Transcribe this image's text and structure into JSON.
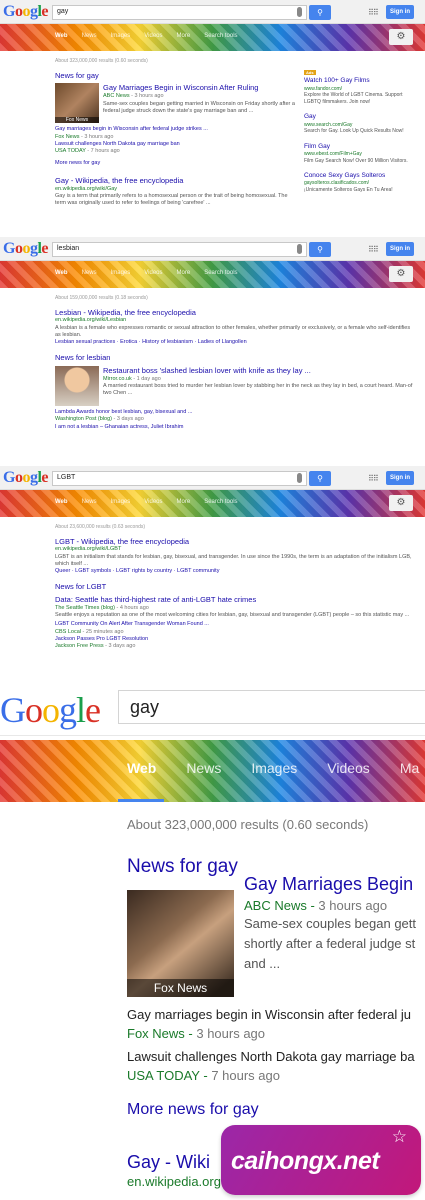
{
  "logo": {
    "g1": "G",
    "o1": "o",
    "o2": "o",
    "g2": "g",
    "l": "l",
    "e": "e"
  },
  "header": {
    "signin": "Sign in"
  },
  "tabs": [
    "Web",
    "News",
    "Images",
    "Videos",
    "More",
    "Search tools"
  ],
  "big_tabs": [
    "Web",
    "News",
    "Images",
    "Videos",
    "Ma"
  ],
  "panel1": {
    "query": "gay",
    "stats": "About 323,000,000 results (0.60 seconds)",
    "news_heading": "News for gay",
    "story": {
      "title": "Gay Marriages Begin in Wisconsin After Ruling",
      "source": "ABC News",
      "time": "3 hours ago",
      "snippet": "Same-sex couples began getting married in Wisconsin on Friday shortly after a federal judge struck down the state's gay marriage ban and ...",
      "thumb_caption": "Fox News"
    },
    "related": [
      {
        "title": "Gay marriages begin in Wisconsin after federal judge strikes ...",
        "source": "Fox News",
        "time": "3 hours ago"
      },
      {
        "title": "Lawsuit challenges North Dakota gay marriage ban",
        "source": "USA TODAY",
        "time": "7 hours ago"
      }
    ],
    "more_news": "More news for gay",
    "result": {
      "title": "Gay - Wikipedia, the free encyclopedia",
      "url": "en.wikipedia.org/wiki/Gay",
      "snippet": "Gay is a term that primarily refers to a homosexual person or the trait of being homosexual. The term was originally used to refer to feelings of being 'carefree' ..."
    },
    "ads": [
      {
        "title": "Watch 100+ Gay Films",
        "url": "www.fandor.com/",
        "desc": "Explore the World of LGBT Cinema. Support LGBTQ filmmakers. Join now!"
      },
      {
        "title": "Gay",
        "url": "www.search.com/Gay",
        "desc": "Search for Gay. Look Up Quick Results Now!"
      },
      {
        "title": "Film Gay",
        "url": "www.ebest.com/Film+Gay",
        "desc": "Film Gay Search Now! Over 90 Million Visitors."
      },
      {
        "title": "Conoce Sexy Gays Solteros",
        "url": "gaysolteros.clasificados.com/",
        "desc": "¡Unicamente Solteros Gays En Tu Area!"
      }
    ],
    "ad_tag": "Ads"
  },
  "panel2": {
    "query": "lesbian",
    "stats": "About 159,000,000 results (0.18 seconds)",
    "result": {
      "title": "Lesbian - Wikipedia, the free encyclopedia",
      "url": "en.wikipedia.org/wiki/Lesbian",
      "snippet": "A lesbian is a female who expresses romantic or sexual attraction to other females, whether primarily or exclusively, or a female who self-identifies as lesbian.",
      "sitelinks": "Lesbian sexual practices · Erotica · History of lesbianism · Ladies of Llangollen"
    },
    "news_heading": "News for lesbian",
    "story": {
      "title": "Restaurant boss 'slashed lesbian lover with knife as they lay ...",
      "source": "Mirror.co.uk",
      "time": "1 day ago",
      "snippet": "A married restaurant boss tried to murder her lesbian lover by stabbing her in the neck as they lay in bed, a court heard. Man-of two Chen ..."
    },
    "related": [
      {
        "title": "Lambda Awards honor best lesbian, gay, bisexual and ...",
        "source": "Washington Post (blog)",
        "time": "3 days ago"
      },
      {
        "title": "I am not a lesbian – Ghanaian actress, Juliet Ibrahim",
        "source": "",
        "time": ""
      }
    ]
  },
  "panel3": {
    "query": "LGBT",
    "stats": "About 23,600,000 results (0.63 seconds)",
    "result": {
      "title": "LGBT - Wikipedia, the free encyclopedia",
      "url": "en.wikipedia.org/wiki/LGBT",
      "snippet": "LGBT is an initialism that stands for lesbian, gay, bisexual, and transgender. In use since the 1990s, the term is an adaptation of the initialism LGB, which itself ...",
      "sitelinks": "Queer · LGBT symbols · LGBT rights by country · LGBT community"
    },
    "news_heading": "News for LGBT",
    "story": {
      "title": "Data: Seattle has third-highest rate of anti-LGBT hate crimes",
      "source": "The Seattle Times (blog)",
      "time": "4 hours ago",
      "snippet": "Seattle enjoys a reputation as one of the most welcoming cities for lesbian, gay, bisexual and transgender (LGBT) people – so this statistic may ..."
    },
    "related": [
      {
        "title": "LGBT Community On Alert After Transgender Woman Found ...",
        "source": "CBS Local",
        "time": "25 minutes ago"
      },
      {
        "title": "Jackson Passes Pro LGBT Resolution",
        "source": "Jackson Free Press",
        "time": "3 days ago"
      }
    ]
  },
  "big": {
    "query": "gay",
    "stats": "About 323,000,000 results (0.60 seconds)",
    "news_heading": "News for gay",
    "story_title": "Gay Marriages Begin",
    "story_source": "ABC News",
    "story_time": "3 hours ago",
    "story_snippet_1": "Same-sex couples began gett",
    "story_snippet_2": "shortly after a federal judge st",
    "story_snippet_3": "and ...",
    "thumb_caption": "Fox News",
    "rel1_title": "Gay marriages begin in Wisconsin after federal ju",
    "rel1_source": "Fox News",
    "rel1_time": "3 hours ago",
    "rel2_title": "Lawsuit challenges North Dakota gay marriage ba",
    "rel2_source": "USA TODAY",
    "rel2_time": "7 hours ago",
    "more_news": "More news for gay",
    "result_title": "Gay - Wiki",
    "result_url": "en.wikipedia.org"
  },
  "watermark": {
    "text": "caihongx.net",
    "star": "☆"
  },
  "colors": {
    "link": "#1a0dab",
    "url": "#1a7a2a",
    "button": "#4584ee",
    "watermark": "#9b27a8"
  }
}
